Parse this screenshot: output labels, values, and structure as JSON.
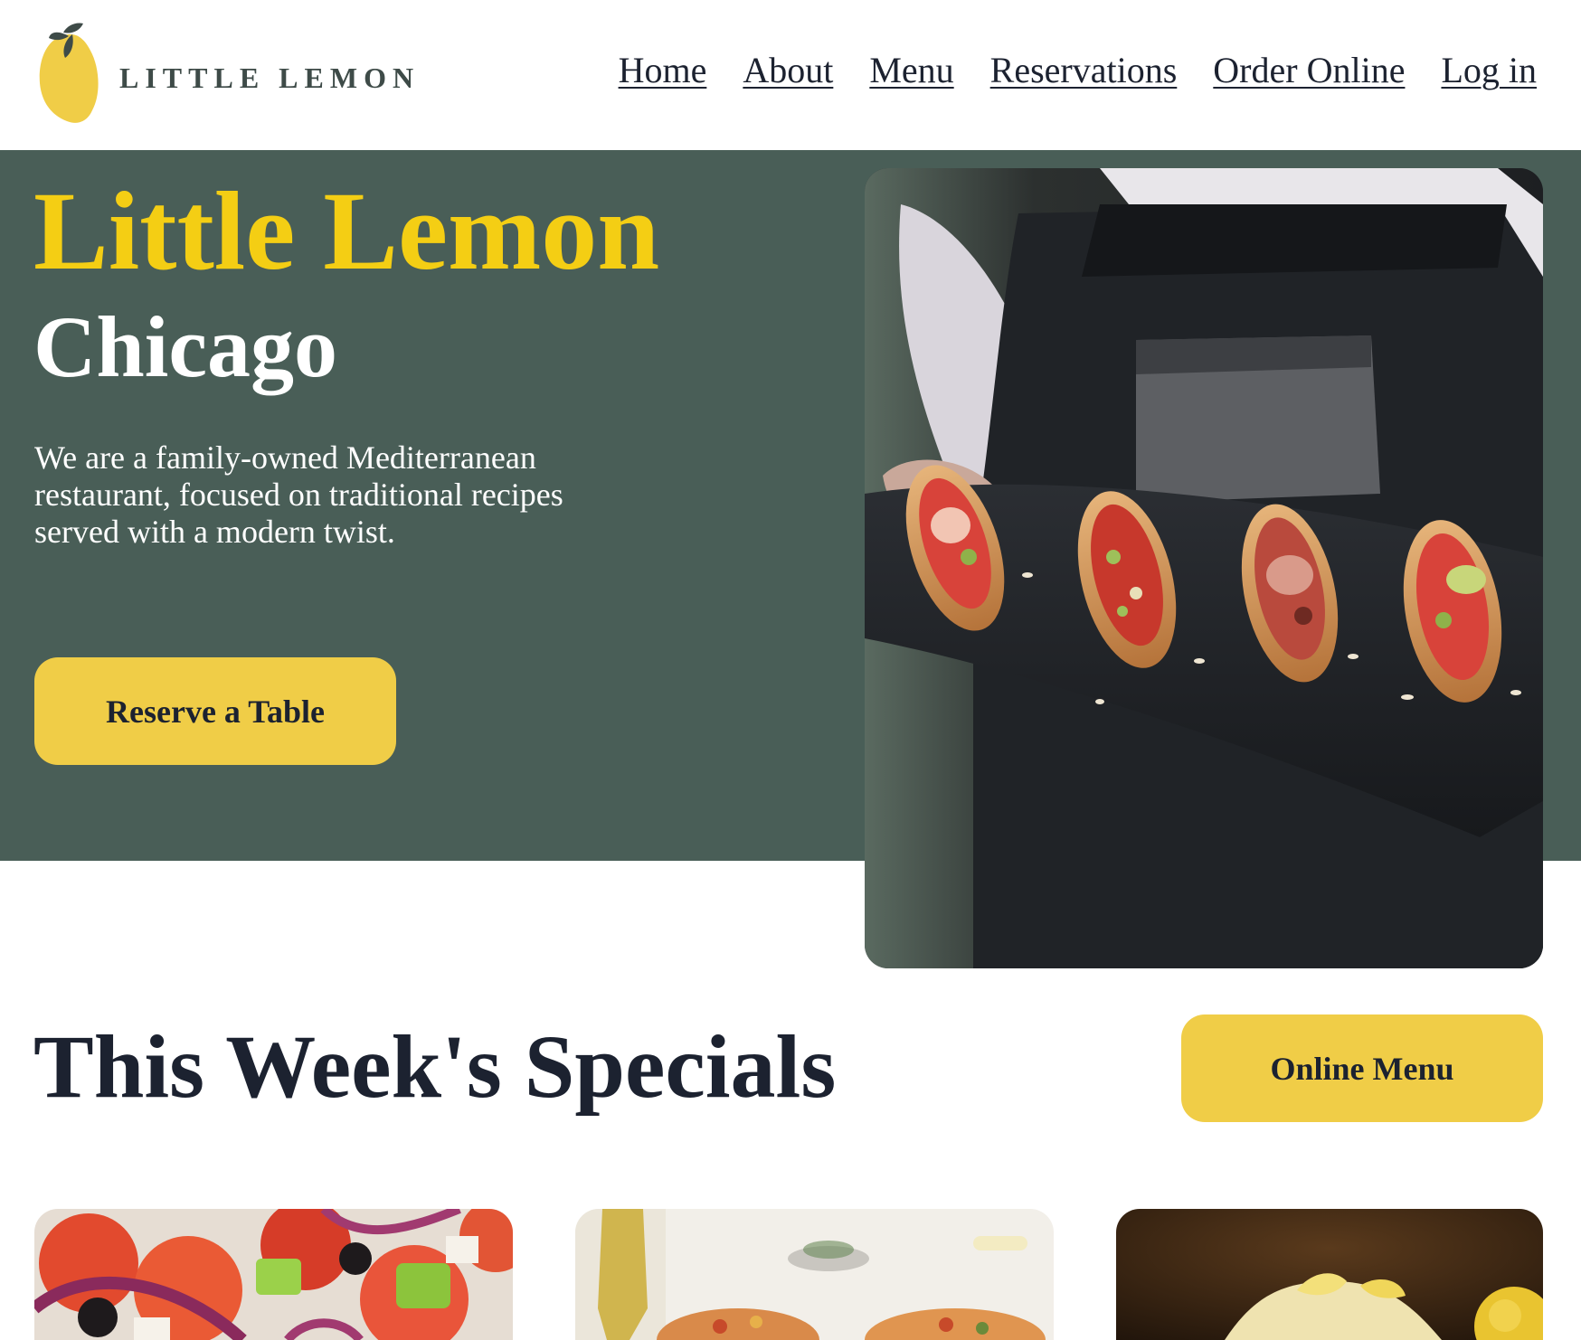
{
  "header": {
    "logo_text": "LITTLE LEMON",
    "nav": [
      "Home",
      "About",
      "Menu",
      "Reservations",
      "Order Online",
      "Log in"
    ]
  },
  "hero": {
    "title": "Little Lemon",
    "city": "Chicago",
    "description": "We are a family-owned Mediterranean restaurant, focused on traditional recipes served with a modern twist.",
    "cta": "Reserve a Table"
  },
  "specials": {
    "title": "This Week's Specials",
    "cta": "Online Menu"
  },
  "colors": {
    "primary_green": "#495e57",
    "primary_yellow": "#f4ce14",
    "button_yellow": "#f0cd47",
    "text_dark": "#1c2230"
  }
}
